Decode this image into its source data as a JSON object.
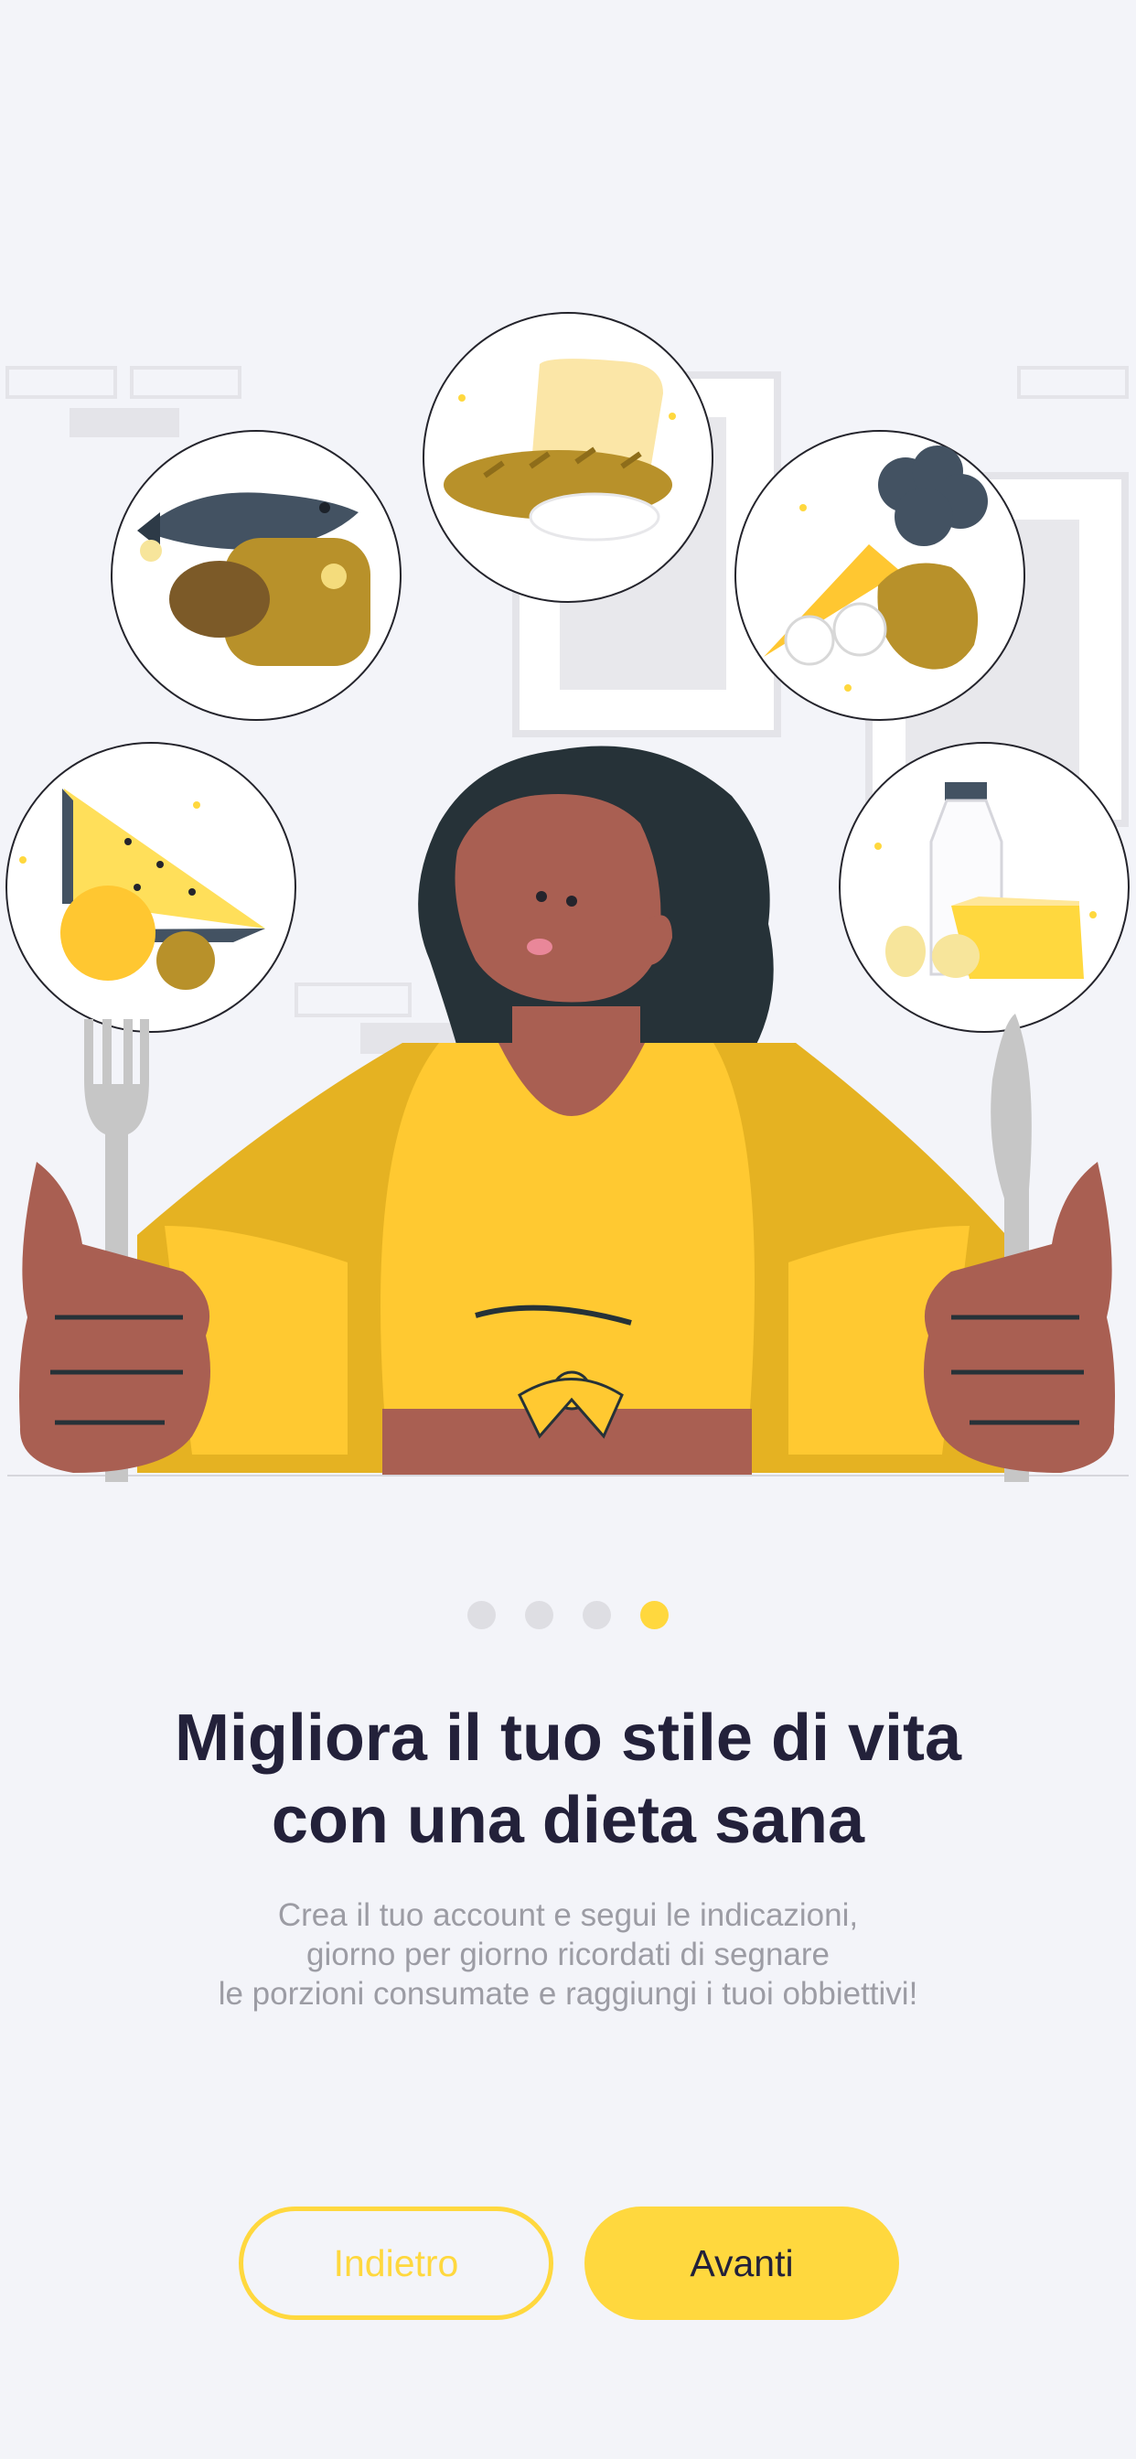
{
  "carousel": {
    "count": 4,
    "active_index": 3
  },
  "content": {
    "title_line1": "Migliora il tuo stile di vita",
    "title_line2": "con una dieta sana",
    "subtitle_line1": "Crea il tuo account e segui le indicazioni,",
    "subtitle_line2": "giorno per giorno ricordati di segnare",
    "subtitle_line3": "le porzioni consumate e raggiungi i tuoi obbiettivi!"
  },
  "buttons": {
    "back_label": "Indietro",
    "next_label": "Avanti"
  },
  "colors": {
    "accent": "#ffd83e",
    "background": "#f3f4f9",
    "title": "#23213a",
    "subtitle": "#9c9ca4",
    "dot_inactive": "#dedee3"
  },
  "illustration": {
    "description_icons": [
      "fish-meat-icon",
      "bread-icon",
      "vegetables-icon",
      "fruit-icon",
      "dairy-icon",
      "woman-with-cutlery"
    ]
  }
}
